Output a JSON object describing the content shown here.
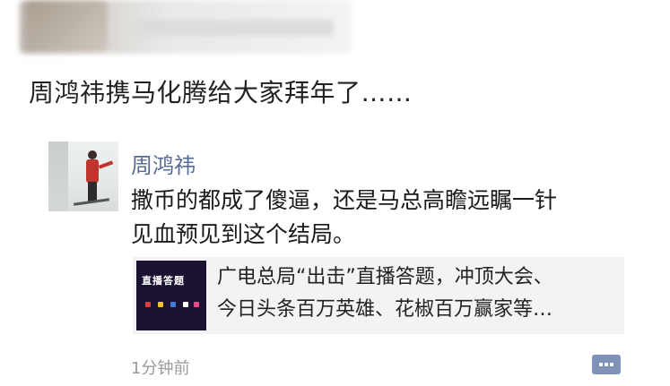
{
  "caption": "周鸿祎携马化腾给大家拜年了……",
  "post": {
    "author": "周鸿祎",
    "text_line1": "撒币的都成了傻逼，还是马总高瞻远瞩一针",
    "text_line2": "见血预见到这个结局。",
    "link": {
      "thumb_title": "直播答题",
      "title_line1": "广电总局“出击”直播答题，冲顶大会、",
      "title_line2": "今日头条百万英雄、花椒百万赢家等…"
    },
    "time": "1分钟前"
  },
  "colors": {
    "author_name": "#576b95",
    "comment_button": "#7f93b8"
  },
  "icons": {
    "comment": "comment-icon"
  }
}
